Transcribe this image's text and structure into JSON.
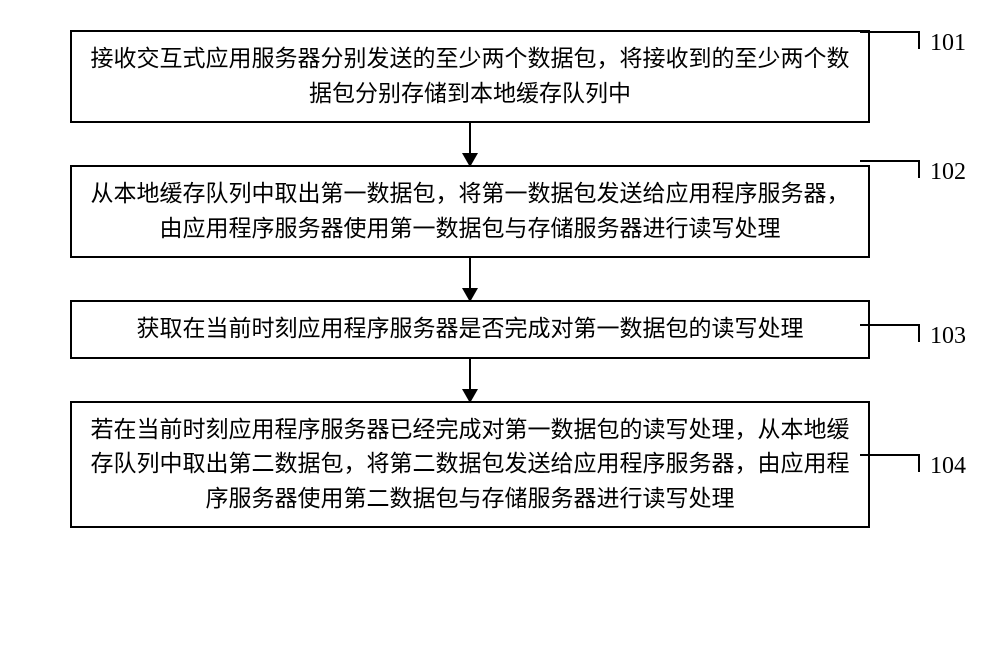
{
  "steps": [
    {
      "id": "101",
      "text": "接收交互式应用服务器分别发送的至少两个数据包，将接收到的至少两个数据包分别存储到本地缓存队列中"
    },
    {
      "id": "102",
      "text": "从本地缓存队列中取出第一数据包，将第一数据包发送给应用程序服务器，由应用程序服务器使用第一数据包与存储服务器进行读写处理"
    },
    {
      "id": "103",
      "text": "获取在当前时刻应用程序服务器是否完成对第一数据包的读写处理"
    },
    {
      "id": "104",
      "text": "若在当前时刻应用程序服务器已经完成对第一数据包的读写处理，从本地缓存队列中取出第二数据包，将第二数据包发送给应用程序服务器，由应用程序服务器使用第二数据包与存储服务器进行读写处理"
    }
  ]
}
